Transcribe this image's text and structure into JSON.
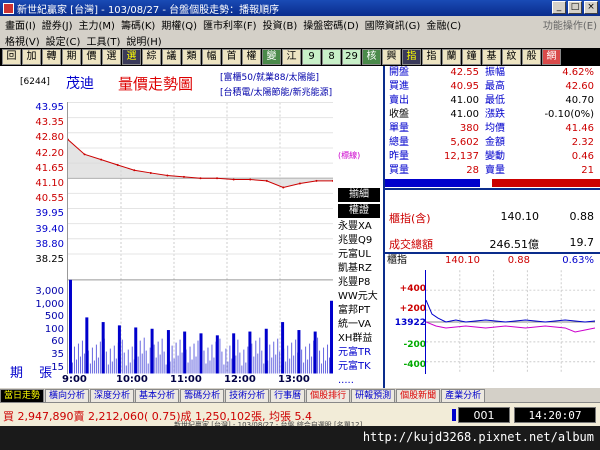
{
  "window": {
    "title": "新世紀贏家 [台灣] - 103/08/27 - 台盤個股走勢：播報順序",
    "buttons": [
      "_",
      "□",
      "×"
    ]
  },
  "menu": {
    "row1": [
      "畫面(I)",
      "證券(J)",
      "主力(M)",
      "籌碼(K)",
      "期權(Q)",
      "匯市利率(F)",
      "投資(B)",
      "操盤密碼(D)",
      "國際資訊(G)",
      "金融(C)",
      "功能操作(E)"
    ],
    "row2": [
      "格視(V)",
      "設定(C)",
      "工具(T)",
      "說明(H)"
    ]
  },
  "toolbar": [
    "回",
    "加",
    "轉",
    "期",
    "價",
    "選",
    "選",
    "綜",
    "議",
    "類",
    "幅",
    "首",
    "權",
    "變",
    "江",
    "9",
    "8",
    "29",
    "核",
    "興",
    "指",
    "指",
    "蘭",
    "鐘",
    "基",
    "紋",
    "般",
    "網"
  ],
  "chart": {
    "code": "[6244]",
    "stock_name": "茂迪",
    "title": "量價走勢圖",
    "tags": [
      "[富櫃50/就業88/太陽能]",
      "[台積電/太陽節能/新兆能源]"
    ],
    "price_labels": [
      "43.95",
      "43.35",
      "42.80",
      "42.20",
      "41.65",
      "41.10",
      "40.55",
      "39.95",
      "39.40",
      "38.80",
      "38.25"
    ],
    "ref_label": "(標線)",
    "volume_labels": [
      "3,000",
      "1,000",
      "500",
      "100",
      "60",
      "35",
      "15"
    ],
    "volume_word": "期 張",
    "time_labels": [
      "9:00",
      "10:00",
      "11:00",
      "12:00",
      "13:00"
    ]
  },
  "chart_data": {
    "type": "line",
    "x": [
      "9:00",
      "9:05",
      "9:10",
      "9:20",
      "9:30",
      "9:45",
      "10:00",
      "10:30",
      "11:00",
      "11:30",
      "12:00",
      "12:30",
      "12:50",
      "13:00",
      "13:10",
      "13:20",
      "13:30"
    ],
    "series": [
      {
        "values": [
          42.55,
          42.0,
          41.8,
          41.6,
          41.4,
          41.3,
          41.2,
          41.15,
          41.1,
          41.1,
          41.05,
          41.05,
          41.0,
          40.75,
          40.9,
          41.0,
          41.0
        ]
      }
    ],
    "reference_price": 41.1,
    "volume": [
      3000,
      120,
      80,
      60,
      50,
      45,
      40,
      35,
      30,
      25,
      30,
      35,
      45,
      80,
      40,
      35,
      500
    ],
    "ylim": [
      38.25,
      43.95
    ]
  },
  "brokers": {
    "header": "揃細",
    "header2": "權證",
    "items": [
      "永豐XA",
      "兆豐Q9",
      "元富UL",
      "凱基RZ",
      "兆豐P8",
      "WW元大",
      "富邦PT",
      "統一VA",
      "XH群益",
      "元富TR",
      "元富TK",
      "....."
    ]
  },
  "quote": {
    "rows": [
      [
        "開盤",
        "42.55",
        "振幅",
        "4.62%"
      ],
      [
        "買進",
        "40.95",
        "最高",
        "42.60"
      ],
      [
        "賣出",
        "41.00",
        "最低",
        "40.70"
      ],
      [
        "收盤",
        "41.00",
        "漲跌",
        "-0.10(0%)"
      ],
      [
        "單量",
        "380",
        "均價",
        "41.46"
      ],
      [
        "總量",
        "5,602",
        "金額",
        "2.32"
      ],
      [
        "昨量",
        "12,137",
        "變動",
        "0.46"
      ],
      [
        "買量",
        "28",
        "賣量",
        "21"
      ]
    ],
    "bar_colors": {
      "buy": "#0000cc",
      "sell": "#cc0000",
      "mid": "#ffffff"
    }
  },
  "index_panel": {
    "label": "櫃指(含)",
    "value": "140.10",
    "change": "0.88",
    "label2": "成交總額",
    "value2": "246.51億",
    "change2": "19.7"
  },
  "mini_chart": {
    "label": "櫃指",
    "value": "140.10",
    "change": "0.88",
    "pct": "0.63%",
    "y_labels": [
      "+400",
      "+200",
      "13922",
      "-200",
      "-400"
    ]
  },
  "tabs": [
    "當日走勢",
    "橫向分析",
    "深度分析",
    "基本分析",
    "籌碼分析",
    "技術分析",
    "行事曆",
    "個股排行",
    "研報預測",
    "個股新聞",
    "產業分析"
  ],
  "status": {
    "text": "買 2,947,890賣 2,212,060( 0.75)成 1,250,102張, 均張 5.4",
    "footer": "新世紀贏家 [台灣] - 103/08/27 - 台盤 綜合自選股 [名單12]",
    "code": "001",
    "time": "14:20:07"
  },
  "watermark": "http://kujd3268.pixnet.net/album"
}
